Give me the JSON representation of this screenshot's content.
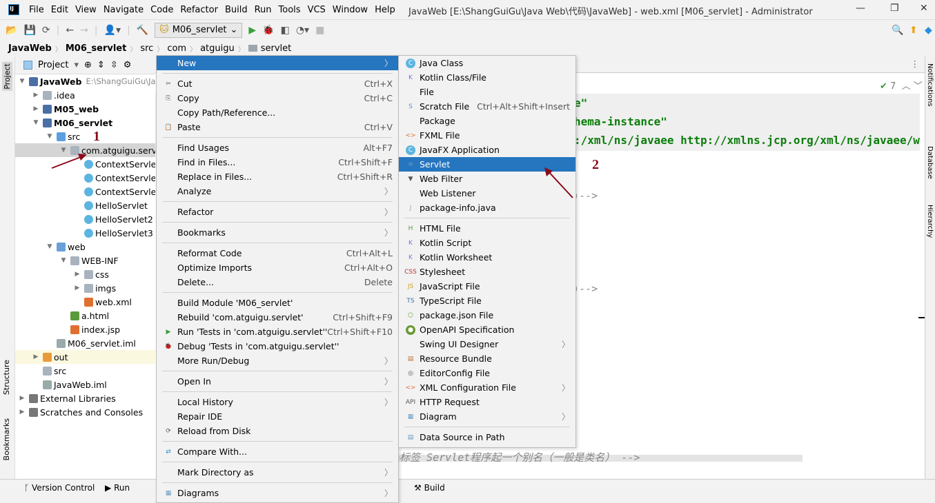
{
  "window": {
    "title": "JavaWeb [E:\\ShangGuiGu\\Java Web\\代码\\JavaWeb] - web.xml [M06_servlet] - Administrator",
    "logo": "IJ"
  },
  "menubar": [
    "File",
    "Edit",
    "View",
    "Navigate",
    "Code",
    "Refactor",
    "Build",
    "Run",
    "Tools",
    "VCS",
    "Window",
    "Help"
  ],
  "toolbar": {
    "run_config": "M06_servlet"
  },
  "breadcrumb": [
    "JavaWeb",
    "M06_servlet",
    "src",
    "com",
    "atguigu",
    "servlet"
  ],
  "left_stripe": {
    "project": "Project",
    "structure": "Structure",
    "bookmarks": "Bookmarks"
  },
  "right_stripe": {
    "notifications": "Notifications",
    "database": "Database",
    "hierarchy": "Hierarchy"
  },
  "project_panel": {
    "title": "Project",
    "tree": [
      {
        "label": "JavaWeb",
        "hint": "E:\\ShangGuiGu\\Ja",
        "depth": 0,
        "arrow": "down",
        "icon": "module",
        "bold": true
      },
      {
        "label": ".idea",
        "depth": 1,
        "arrow": "right",
        "icon": "folder"
      },
      {
        "label": "M05_web",
        "depth": 1,
        "arrow": "right",
        "icon": "module",
        "bold": true
      },
      {
        "label": "M06_servlet",
        "depth": 1,
        "arrow": "down",
        "icon": "module",
        "bold": true
      },
      {
        "label": "src",
        "depth": 2,
        "arrow": "down",
        "icon": "src-folder"
      },
      {
        "label": "com.atguigu.servlet",
        "depth": 3,
        "arrow": "down",
        "icon": "package",
        "selected": true
      },
      {
        "label": "ContextServlet",
        "depth": 4,
        "icon": "class"
      },
      {
        "label": "ContextServlet",
        "depth": 4,
        "icon": "class"
      },
      {
        "label": "ContextServlet",
        "depth": 4,
        "icon": "class"
      },
      {
        "label": "HelloServlet",
        "depth": 4,
        "icon": "class"
      },
      {
        "label": "HelloServlet2",
        "depth": 4,
        "icon": "class"
      },
      {
        "label": "HelloServlet3",
        "depth": 4,
        "icon": "class"
      },
      {
        "label": "web",
        "depth": 2,
        "arrow": "down",
        "icon": "web-folder"
      },
      {
        "label": "WEB-INF",
        "depth": 3,
        "arrow": "down",
        "icon": "folder"
      },
      {
        "label": "css",
        "depth": 4,
        "arrow": "right",
        "icon": "folder"
      },
      {
        "label": "imgs",
        "depth": 4,
        "arrow": "right",
        "icon": "folder"
      },
      {
        "label": "web.xml",
        "depth": 4,
        "icon": "xml"
      },
      {
        "label": "a.html",
        "depth": 3,
        "icon": "html"
      },
      {
        "label": "index.jsp",
        "depth": 3,
        "icon": "jsp"
      },
      {
        "label": "M06_servlet.iml",
        "depth": 2,
        "icon": "iml"
      },
      {
        "label": "out",
        "depth": 1,
        "arrow": "right",
        "icon": "out-folder",
        "excluded": true
      },
      {
        "label": "src",
        "depth": 1,
        "icon": "folder"
      },
      {
        "label": "JavaWeb.iml",
        "depth": 1,
        "icon": "iml"
      },
      {
        "label": "External Libraries",
        "depth": 0,
        "arrow": "right",
        "icon": "libraries"
      },
      {
        "label": "Scratches and Consoles",
        "depth": 0,
        "arrow": "right",
        "icon": "scratches"
      }
    ]
  },
  "editor": {
    "inspection_count": "7",
    "lines": [
      "e\"",
      "hema-instance\"",
      ":/xml/ns/javaee http://xmlns.jcp.org/xml/ns/javaee/w",
      ")-->",
      ")-->"
    ],
    "comment_line": "e标签 Servlet程序起一个别名（一般是类名） -->"
  },
  "context_menu": [
    {
      "label": "New",
      "sub": true,
      "hl": true
    },
    "-",
    {
      "label": "Cut",
      "icon": "cut",
      "shortcut": "Ctrl+X"
    },
    {
      "label": "Copy",
      "icon": "copy",
      "shortcut": "Ctrl+C"
    },
    {
      "label": "Copy Path/Reference..."
    },
    {
      "label": "Paste",
      "icon": "paste",
      "shortcut": "Ctrl+V"
    },
    "-",
    {
      "label": "Find Usages",
      "shortcut": "Alt+F7"
    },
    {
      "label": "Find in Files...",
      "shortcut": "Ctrl+Shift+F"
    },
    {
      "label": "Replace in Files...",
      "shortcut": "Ctrl+Shift+R"
    },
    {
      "label": "Analyze",
      "sub": true
    },
    "-",
    {
      "label": "Refactor",
      "sub": true
    },
    "-",
    {
      "label": "Bookmarks",
      "sub": true
    },
    "-",
    {
      "label": "Reformat Code",
      "shortcut": "Ctrl+Alt+L"
    },
    {
      "label": "Optimize Imports",
      "shortcut": "Ctrl+Alt+O"
    },
    {
      "label": "Delete...",
      "shortcut": "Delete"
    },
    "-",
    {
      "label": "Build Module 'M06_servlet'"
    },
    {
      "label": "Rebuild 'com.atguigu.servlet'",
      "shortcut": "Ctrl+Shift+F9"
    },
    {
      "label": "Run 'Tests in 'com.atguigu.servlet''",
      "icon": "run",
      "shortcut": "Ctrl+Shift+F10"
    },
    {
      "label": "Debug 'Tests in 'com.atguigu.servlet''",
      "icon": "debug"
    },
    {
      "label": "More Run/Debug",
      "sub": true
    },
    "-",
    {
      "label": "Open In",
      "sub": true
    },
    "-",
    {
      "label": "Local History",
      "sub": true
    },
    {
      "label": "Repair IDE"
    },
    {
      "label": "Reload from Disk",
      "icon": "reload"
    },
    "-",
    {
      "label": "Compare With...",
      "icon": "compare"
    },
    "-",
    {
      "label": "Mark Directory as",
      "sub": true
    },
    "-",
    {
      "label": "Diagrams",
      "icon": "diagram",
      "sub": true
    }
  ],
  "new_submenu": [
    {
      "label": "Java Class",
      "icon": "class"
    },
    {
      "label": "Kotlin Class/File",
      "icon": "kotlin"
    },
    {
      "label": "File",
      "icon": "file"
    },
    {
      "label": "Scratch File",
      "icon": "scratch",
      "shortcut": "Ctrl+Alt+Shift+Insert"
    },
    {
      "label": "Package",
      "icon": "package"
    },
    {
      "label": "FXML File",
      "icon": "fxml"
    },
    {
      "label": "JavaFX Application",
      "icon": "class"
    },
    {
      "label": "Servlet",
      "icon": "servlet",
      "hl": true
    },
    {
      "label": "Web Filter",
      "icon": "filter"
    },
    {
      "label": "Web Listener",
      "icon": "listener"
    },
    {
      "label": "package-info.java",
      "icon": "java-file"
    },
    "-",
    {
      "label": "HTML File",
      "icon": "html"
    },
    {
      "label": "Kotlin Script",
      "icon": "kotlin"
    },
    {
      "label": "Kotlin Worksheet",
      "icon": "kotlin"
    },
    {
      "label": "Stylesheet",
      "icon": "css"
    },
    {
      "label": "JavaScript File",
      "icon": "js"
    },
    {
      "label": "TypeScript File",
      "icon": "ts"
    },
    {
      "label": "package.json File",
      "icon": "npm"
    },
    {
      "label": "OpenAPI Specification",
      "icon": "openapi"
    },
    {
      "label": "Swing UI Designer",
      "sub": true
    },
    {
      "label": "Resource Bundle",
      "icon": "bundle"
    },
    {
      "label": "EditorConfig File",
      "icon": "editorconfig"
    },
    {
      "label": "XML Configuration File",
      "icon": "xml",
      "sub": true
    },
    {
      "label": "HTTP Request",
      "icon": "api"
    },
    {
      "label": "Diagram",
      "icon": "diagram",
      "sub": true
    },
    "-",
    {
      "label": "Data Source in Path",
      "icon": "database"
    }
  ],
  "annotations": {
    "step1": "1",
    "step2": "2",
    "color": "#8b0a1a"
  },
  "bottom_bar": {
    "version_control": "Version Control",
    "run": "Run",
    "build": "Build"
  }
}
